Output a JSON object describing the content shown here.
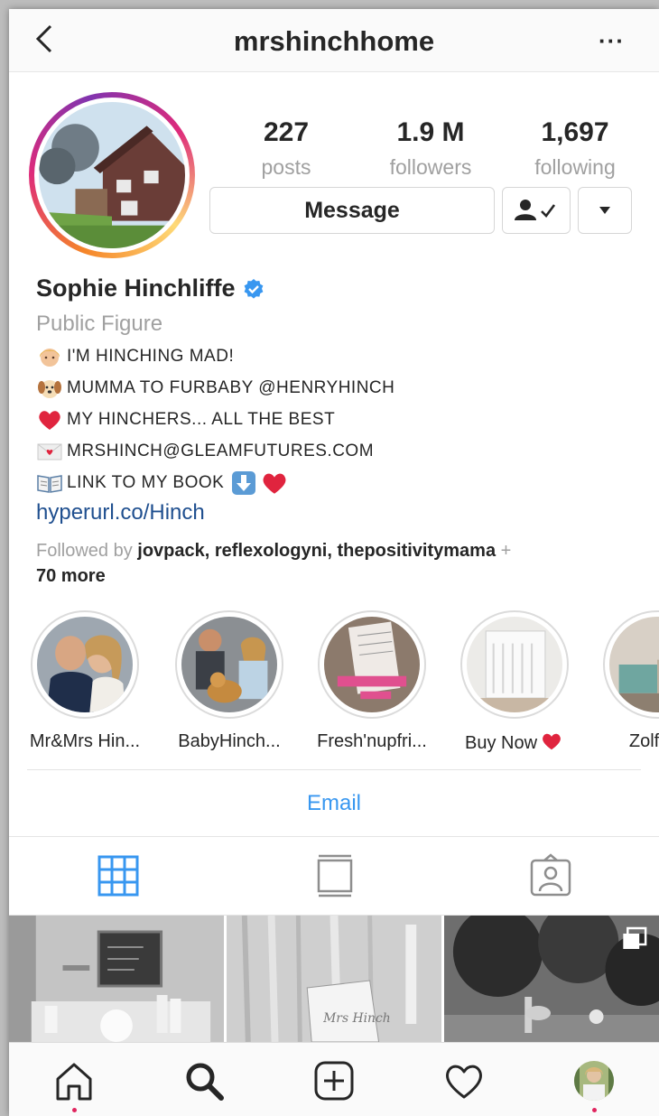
{
  "header": {
    "username": "mrshinchhome",
    "back_icon": "chevron-left-icon",
    "more_label": "···"
  },
  "profile": {
    "stats": [
      {
        "value": "227",
        "label": "posts"
      },
      {
        "value": "1.9 M",
        "label": "followers"
      },
      {
        "value": "1,697",
        "label": "following"
      }
    ],
    "message_label": "Message",
    "full_name": "Sophie Hinchliffe",
    "verified": true,
    "category": "Public Figure",
    "bio_lines": [
      {
        "emoji": "woman-face-emoji",
        "text": "I'M HINCHING MAD!"
      },
      {
        "emoji": "dog-face-emoji",
        "text": "MUMMA TO FURBABY @HENRYHINCH"
      },
      {
        "emoji": "red-heart-emoji",
        "text": "MY HINCHERS... ALL THE BEST"
      },
      {
        "emoji": "love-letter-emoji",
        "text": "MRSHINCH@GLEAMFUTURES.COM"
      },
      {
        "emoji": "open-book-emoji",
        "text": "LINK TO MY BOOK"
      }
    ],
    "link": "hyperurl.co/Hinch",
    "followed_by_prefix": "Followed by ",
    "followed_by_names": "jovpack, reflexologyni, thepositivitymama",
    "followed_by_suffix": " +",
    "followed_by_more": "70 more"
  },
  "highlights": [
    {
      "label": "Mr&Mrs Hin..."
    },
    {
      "label": "BabyHinch..."
    },
    {
      "label": "Fresh'nupfri..."
    },
    {
      "label": "Buy Now"
    },
    {
      "label": "Zolfora"
    }
  ],
  "email_label": "Email",
  "tabs": [
    "grid-icon",
    "feed-icon",
    "tagged-icon"
  ],
  "bottom_nav": [
    "home-icon",
    "search-icon",
    "add-icon",
    "heart-icon",
    "profile-avatar"
  ],
  "colors": {
    "link_blue": "#1f4f8f",
    "action_blue": "#3897f0",
    "verified_blue": "#3897f0",
    "muted_text": "#a0a0a0",
    "notification_red": "#e0245e"
  }
}
